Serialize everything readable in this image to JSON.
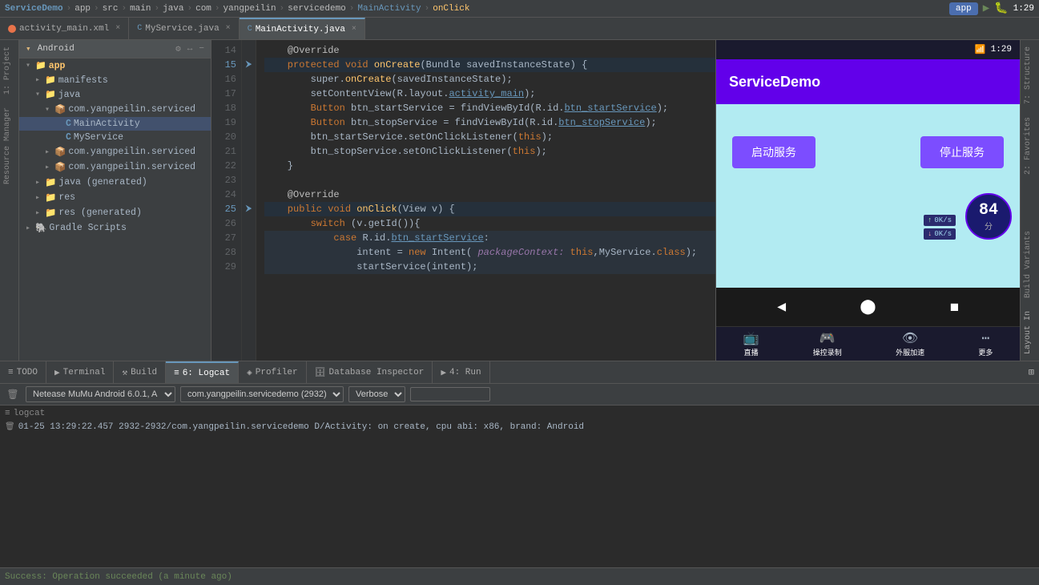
{
  "topbar": {
    "project": "ServiceDemo",
    "separator1": "▸",
    "app": "app",
    "separator2": "▸",
    "src": "src",
    "separator3": "▸",
    "main": "main",
    "separator4": "▸",
    "java": "java",
    "separator5": "▸",
    "com": "com",
    "separator6": "▸",
    "yangpeilin": "yangpeilin",
    "separator7": "▸",
    "servicedemo": "servicedemo",
    "separator8": "▸",
    "mainactivity": "MainActivity",
    "separator9": "▸",
    "onclick": "onClick",
    "run_config": "app",
    "time": "1:29"
  },
  "file_tabs": [
    {
      "id": "activity_main",
      "icon_type": "xml",
      "label": "activity_main.xml",
      "active": false
    },
    {
      "id": "myservice",
      "icon_type": "java-c",
      "label": "MyService.java",
      "active": false
    },
    {
      "id": "mainactivity",
      "icon_type": "java-c",
      "label": "MainActivity.java",
      "active": true
    }
  ],
  "sidebar": {
    "header": "1: Project",
    "root_label": "Android",
    "items": [
      {
        "id": "app",
        "label": "app",
        "indent": 1,
        "type": "folder",
        "expanded": true
      },
      {
        "id": "manifests",
        "label": "manifests",
        "indent": 2,
        "type": "folder",
        "expanded": false
      },
      {
        "id": "java",
        "label": "java",
        "indent": 2,
        "type": "folder",
        "expanded": true
      },
      {
        "id": "pkg1",
        "label": "com.yangpeilin.serviced",
        "indent": 3,
        "type": "package",
        "expanded": true
      },
      {
        "id": "mainactivity",
        "label": "MainActivity",
        "indent": 4,
        "type": "java-c"
      },
      {
        "id": "myservice",
        "label": "MyService",
        "indent": 4,
        "type": "java-c"
      },
      {
        "id": "pkg2",
        "label": "com.yangpeilin.serviced",
        "indent": 3,
        "type": "package",
        "expanded": false
      },
      {
        "id": "pkg3",
        "label": "com.yangpeilin.serviced",
        "indent": 3,
        "type": "package",
        "expanded": false
      },
      {
        "id": "java_gen",
        "label": "java (generated)",
        "indent": 2,
        "type": "folder",
        "expanded": false
      },
      {
        "id": "res",
        "label": "res",
        "indent": 2,
        "type": "folder",
        "expanded": false
      },
      {
        "id": "res_gen",
        "label": "res (generated)",
        "indent": 2,
        "type": "folder",
        "expanded": false
      },
      {
        "id": "gradle",
        "label": "Gradle Scripts",
        "indent": 1,
        "type": "gradle",
        "expanded": false
      }
    ]
  },
  "code": {
    "lines": [
      {
        "num": 14,
        "content": "    @Override",
        "type": "annotation"
      },
      {
        "num": 15,
        "content": "    protected void onCreate(Bundle savedInstanceState) {",
        "type": "normal",
        "exec": true
      },
      {
        "num": 16,
        "content": "        super.onCreate(savedInstanceState);",
        "type": "normal"
      },
      {
        "num": 17,
        "content": "        setContentView(R.layout.activity_main);",
        "type": "normal"
      },
      {
        "num": 18,
        "content": "        Button btn_startService = findViewById(R.id.btn_startService);",
        "type": "normal"
      },
      {
        "num": 19,
        "content": "        Button btn_stopService = findViewById(R.id.btn_stopService);",
        "type": "normal"
      },
      {
        "num": 20,
        "content": "        btn_startService.setOnClickListener(this);",
        "type": "normal"
      },
      {
        "num": 21,
        "content": "        btn_stopService.setOnClickListener(this);",
        "type": "normal"
      },
      {
        "num": 22,
        "content": "    }",
        "type": "normal"
      },
      {
        "num": 23,
        "content": "",
        "type": "normal"
      },
      {
        "num": 24,
        "content": "    @Override",
        "type": "annotation"
      },
      {
        "num": 25,
        "content": "    public void onClick(View v) {",
        "type": "normal",
        "exec": true
      },
      {
        "num": 26,
        "content": "        switch (v.getId()){",
        "type": "normal"
      },
      {
        "num": 27,
        "content": "            case R.id.btn_startService:",
        "type": "normal"
      },
      {
        "num": 28,
        "content": "                intent = new Intent( packageContext: this,MyService.class);",
        "type": "normal"
      },
      {
        "num": 29,
        "content": "                startService(intent);",
        "type": "normal"
      }
    ]
  },
  "logcat": {
    "panel_label": "Logcat",
    "device": "Netease MuMu Android 6.0.1, A",
    "package": "com.yangpeilin.servicedemo (2932)",
    "level": "Verbose",
    "search_placeholder": "",
    "logcat_label": "logcat",
    "log_entry": "01-25 13:29:22.457 2932-2932/com.yangpeilin.servicedemo D/Activity: on create, cpu abi: x86, brand: Android"
  },
  "bottom_tabs": [
    {
      "id": "todo",
      "label": "TODO",
      "icon": "≡",
      "active": false
    },
    {
      "id": "terminal",
      "label": "Terminal",
      "icon": "▶",
      "active": false
    },
    {
      "id": "build",
      "label": "Build",
      "icon": "⚒",
      "active": false
    },
    {
      "id": "logcat",
      "label": "6: Logcat",
      "icon": "≡",
      "active": true
    },
    {
      "id": "profiler",
      "label": "Profiler",
      "icon": "◈",
      "active": false
    },
    {
      "id": "dbinspector",
      "label": "Database Inspector",
      "icon": "🗄",
      "active": false
    },
    {
      "id": "run",
      "label": "4: Run",
      "icon": "▶",
      "active": false
    }
  ],
  "status_bar": {
    "message": "Success: Operation succeeded (a minute ago)"
  },
  "phone": {
    "status_time": "1:29",
    "app_title": "ServiceDemo",
    "start_btn": "启动服务",
    "stop_btn": "停止服务",
    "nav_back": "◀",
    "nav_home": "⬤",
    "nav_recent": "◼",
    "bottom_actions": [
      {
        "id": "live",
        "label": "直播",
        "icon": "📺"
      },
      {
        "id": "control",
        "label": "操控",
        "icon": "🎮"
      },
      {
        "id": "record",
        "label": "外服加速",
        "icon": "👁"
      },
      {
        "id": "more",
        "label": "更多",
        "icon": "⋯"
      }
    ],
    "net_monitor": "84",
    "net_unit": "分",
    "net_up": "0K/s",
    "net_down": "0K/s",
    "layout_in": "Layout In"
  },
  "vertical_labels": [
    {
      "id": "project",
      "label": "1: Project"
    },
    {
      "id": "resource",
      "label": "Resource Manager"
    },
    {
      "id": "structure",
      "label": "7: Structure"
    },
    {
      "id": "favorites",
      "label": "2: Favorites"
    },
    {
      "id": "build_variants",
      "label": "Build Variants"
    }
  ]
}
